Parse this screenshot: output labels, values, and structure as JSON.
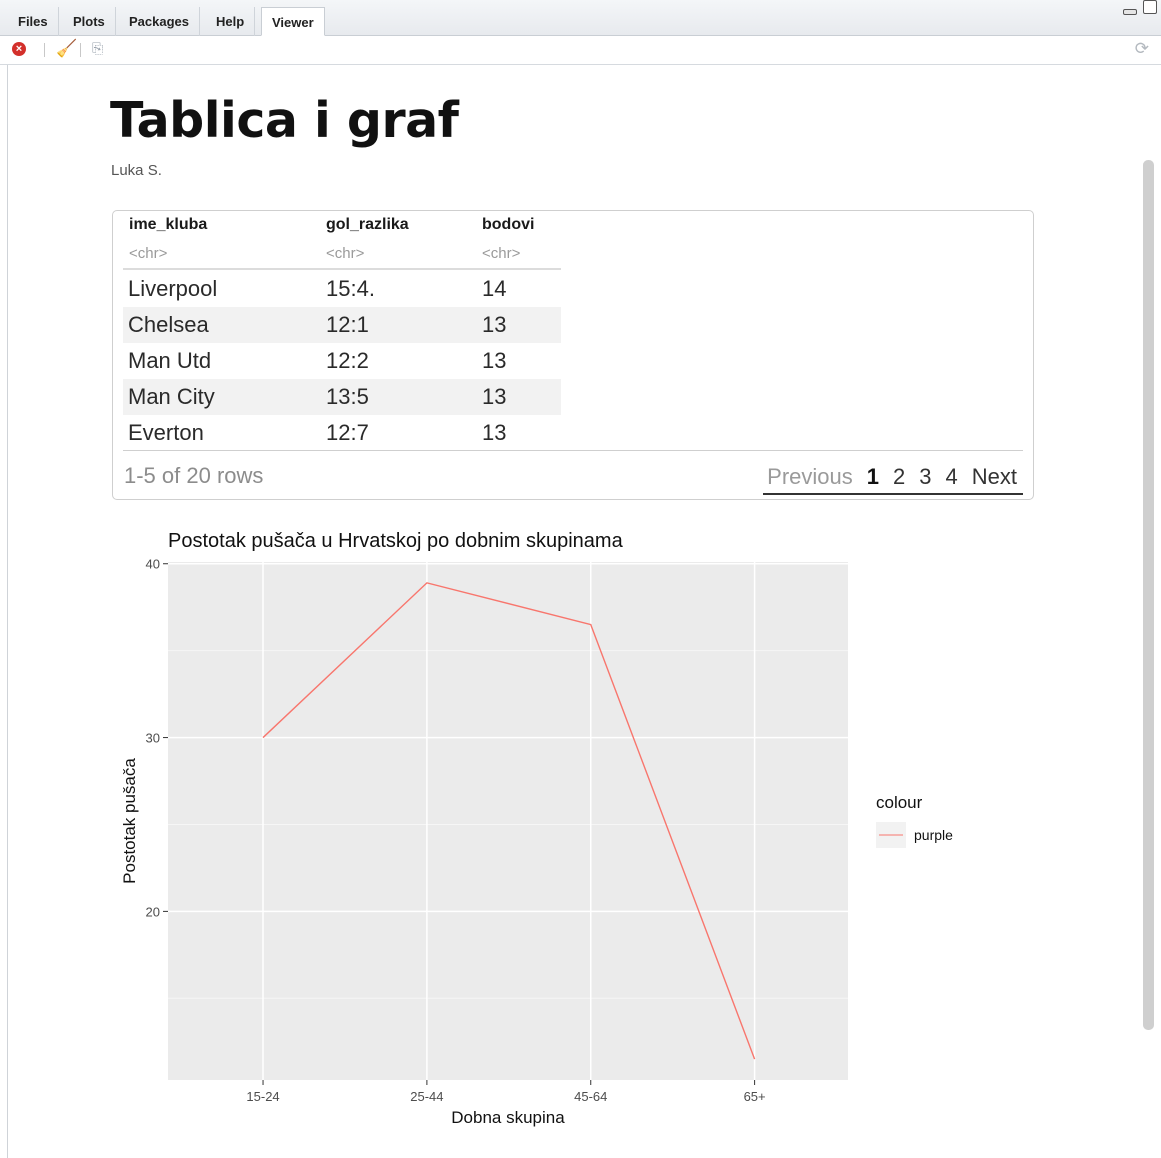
{
  "tabs": [
    {
      "label": "Files",
      "active": false
    },
    {
      "label": "Plots",
      "active": false
    },
    {
      "label": "Packages",
      "active": false
    },
    {
      "label": "Help",
      "active": false
    },
    {
      "label": "Viewer",
      "active": true
    }
  ],
  "toolbar": {
    "icons": [
      "stop-icon",
      "broom-clear-icon",
      "export-icon",
      "refresh-icon"
    ]
  },
  "document": {
    "title": "Tablica i graf",
    "author": "Luka S."
  },
  "table": {
    "columns": [
      {
        "name": "ime_kluba",
        "type": "<chr>"
      },
      {
        "name": "gol_razlika",
        "type": "<chr>"
      },
      {
        "name": "bodovi",
        "type": "<chr>"
      }
    ],
    "rows": [
      [
        "Liverpool",
        "15:4.",
        "14"
      ],
      [
        "Chelsea",
        "12:1",
        "13"
      ],
      [
        "Man Utd",
        "12:2",
        "13"
      ],
      [
        "Man City",
        "13:5",
        "13"
      ],
      [
        "Everton",
        "12:7",
        "13"
      ]
    ],
    "row_count": "1-5 of 20 rows",
    "pager": {
      "previous": "Previous",
      "pages": [
        "1",
        "2",
        "3",
        "4"
      ],
      "current": "1",
      "next": "Next"
    }
  },
  "chart_data": {
    "type": "line",
    "title": "Postotak pušača u Hrvatskoj po dobnim skupinama",
    "xlabel": "Dobna skupina",
    "ylabel": "Postotak pušača",
    "categories": [
      "15-24",
      "25-44",
      "45-64",
      "65+"
    ],
    "series": [
      {
        "name": "purple",
        "values": [
          30.0,
          38.9,
          36.5,
          11.5
        ],
        "color": "#F8766D"
      }
    ],
    "y_ticks": [
      20,
      30,
      40
    ],
    "ylim": [
      10.3,
      40.1
    ],
    "legend": {
      "title": "colour",
      "entries": [
        "purple"
      ],
      "position": "right"
    },
    "grid": true,
    "panel_background": "#EBEBEB"
  }
}
